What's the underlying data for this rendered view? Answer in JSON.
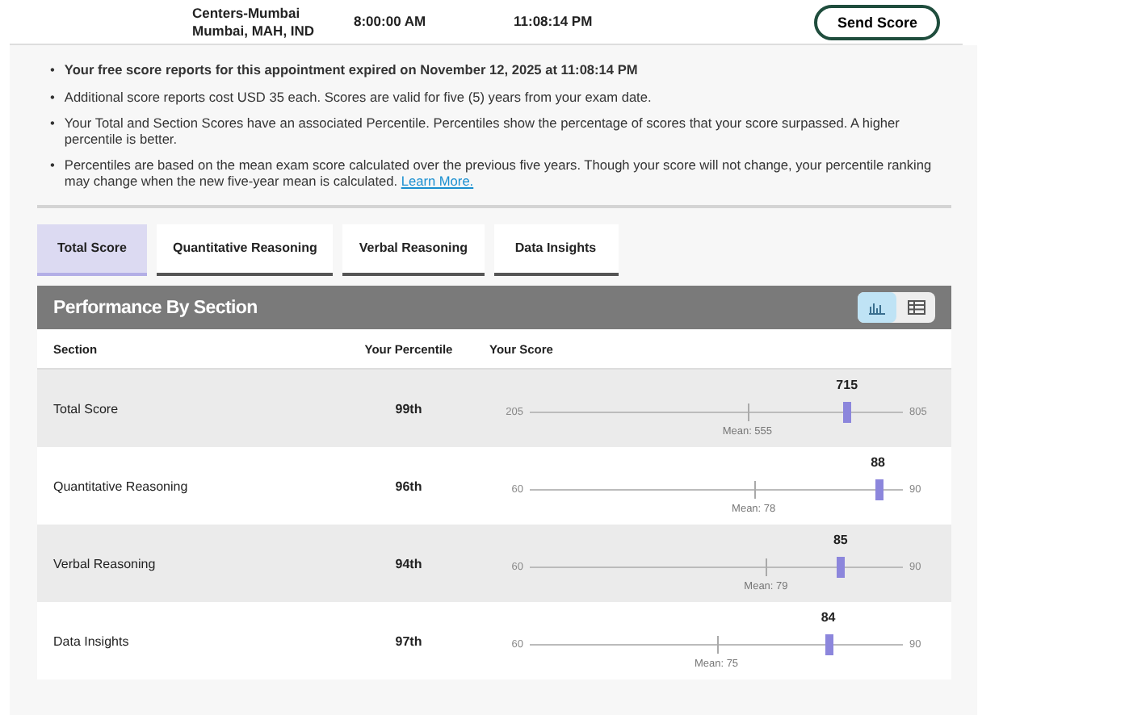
{
  "appointment": {
    "location": [
      "Centers-Mumbai",
      "Mumbai, MAH, IND"
    ],
    "start_time": "8:00:00 AM",
    "end_time": "11:08:14 PM",
    "send_button": "Send Score"
  },
  "bullet": "•",
  "notes": [
    {
      "text": "Your free score reports for this appointment expired on November 12, 2025 at 11:08:14 PM",
      "bold": true
    },
    {
      "text": "Additional score reports cost USD 35 each. Scores are valid for five (5) years from your exam date.",
      "bold": false
    },
    {
      "text": "Your Total and Section Scores have an associated Percentile. Percentiles show the percentage of scores that your score surpassed. A higher percentile is better.",
      "bold": false
    },
    {
      "text": "Percentiles are based on the mean exam score calculated over the previous five years. Though your score will not change, your percentile ranking may change when the new five-year mean is calculated.",
      "bold": false,
      "link": "Learn More."
    }
  ],
  "tabs": [
    {
      "label": "Total Score",
      "selected": true
    },
    {
      "label": "Quantitative Reasoning",
      "selected": false
    },
    {
      "label": "Verbal Reasoning",
      "selected": false
    },
    {
      "label": "Data Insights",
      "selected": false
    }
  ],
  "panel": {
    "title": "Performance By Section",
    "views": [
      {
        "kind": "chart",
        "selected": true
      },
      {
        "kind": "table",
        "selected": false
      }
    ],
    "columns": [
      "Section",
      "Your Percentile",
      "Your Score"
    ],
    "rows": [
      {
        "section": "Total Score",
        "percentile": "99th",
        "min": "205",
        "max": "805",
        "score": "715",
        "level": 0.85,
        "mean": {
          "label": "Mean: 555",
          "level": 0.583
        }
      },
      {
        "section": "Quantitative Reasoning",
        "percentile": "96th",
        "min": "60",
        "max": "90",
        "score": "88",
        "level": 0.933,
        "mean": {
          "label": "Mean: 78",
          "level": 0.6
        }
      },
      {
        "section": "Verbal Reasoning",
        "percentile": "94th",
        "min": "60",
        "max": "90",
        "score": "85",
        "level": 0.833,
        "mean": {
          "label": "Mean: 79",
          "level": 0.633
        }
      },
      {
        "section": "Data Insights",
        "percentile": "97th",
        "min": "60",
        "max": "90",
        "score": "84",
        "level": 0.8,
        "mean": {
          "label": "Mean: 75",
          "level": 0.5
        }
      }
    ]
  }
}
